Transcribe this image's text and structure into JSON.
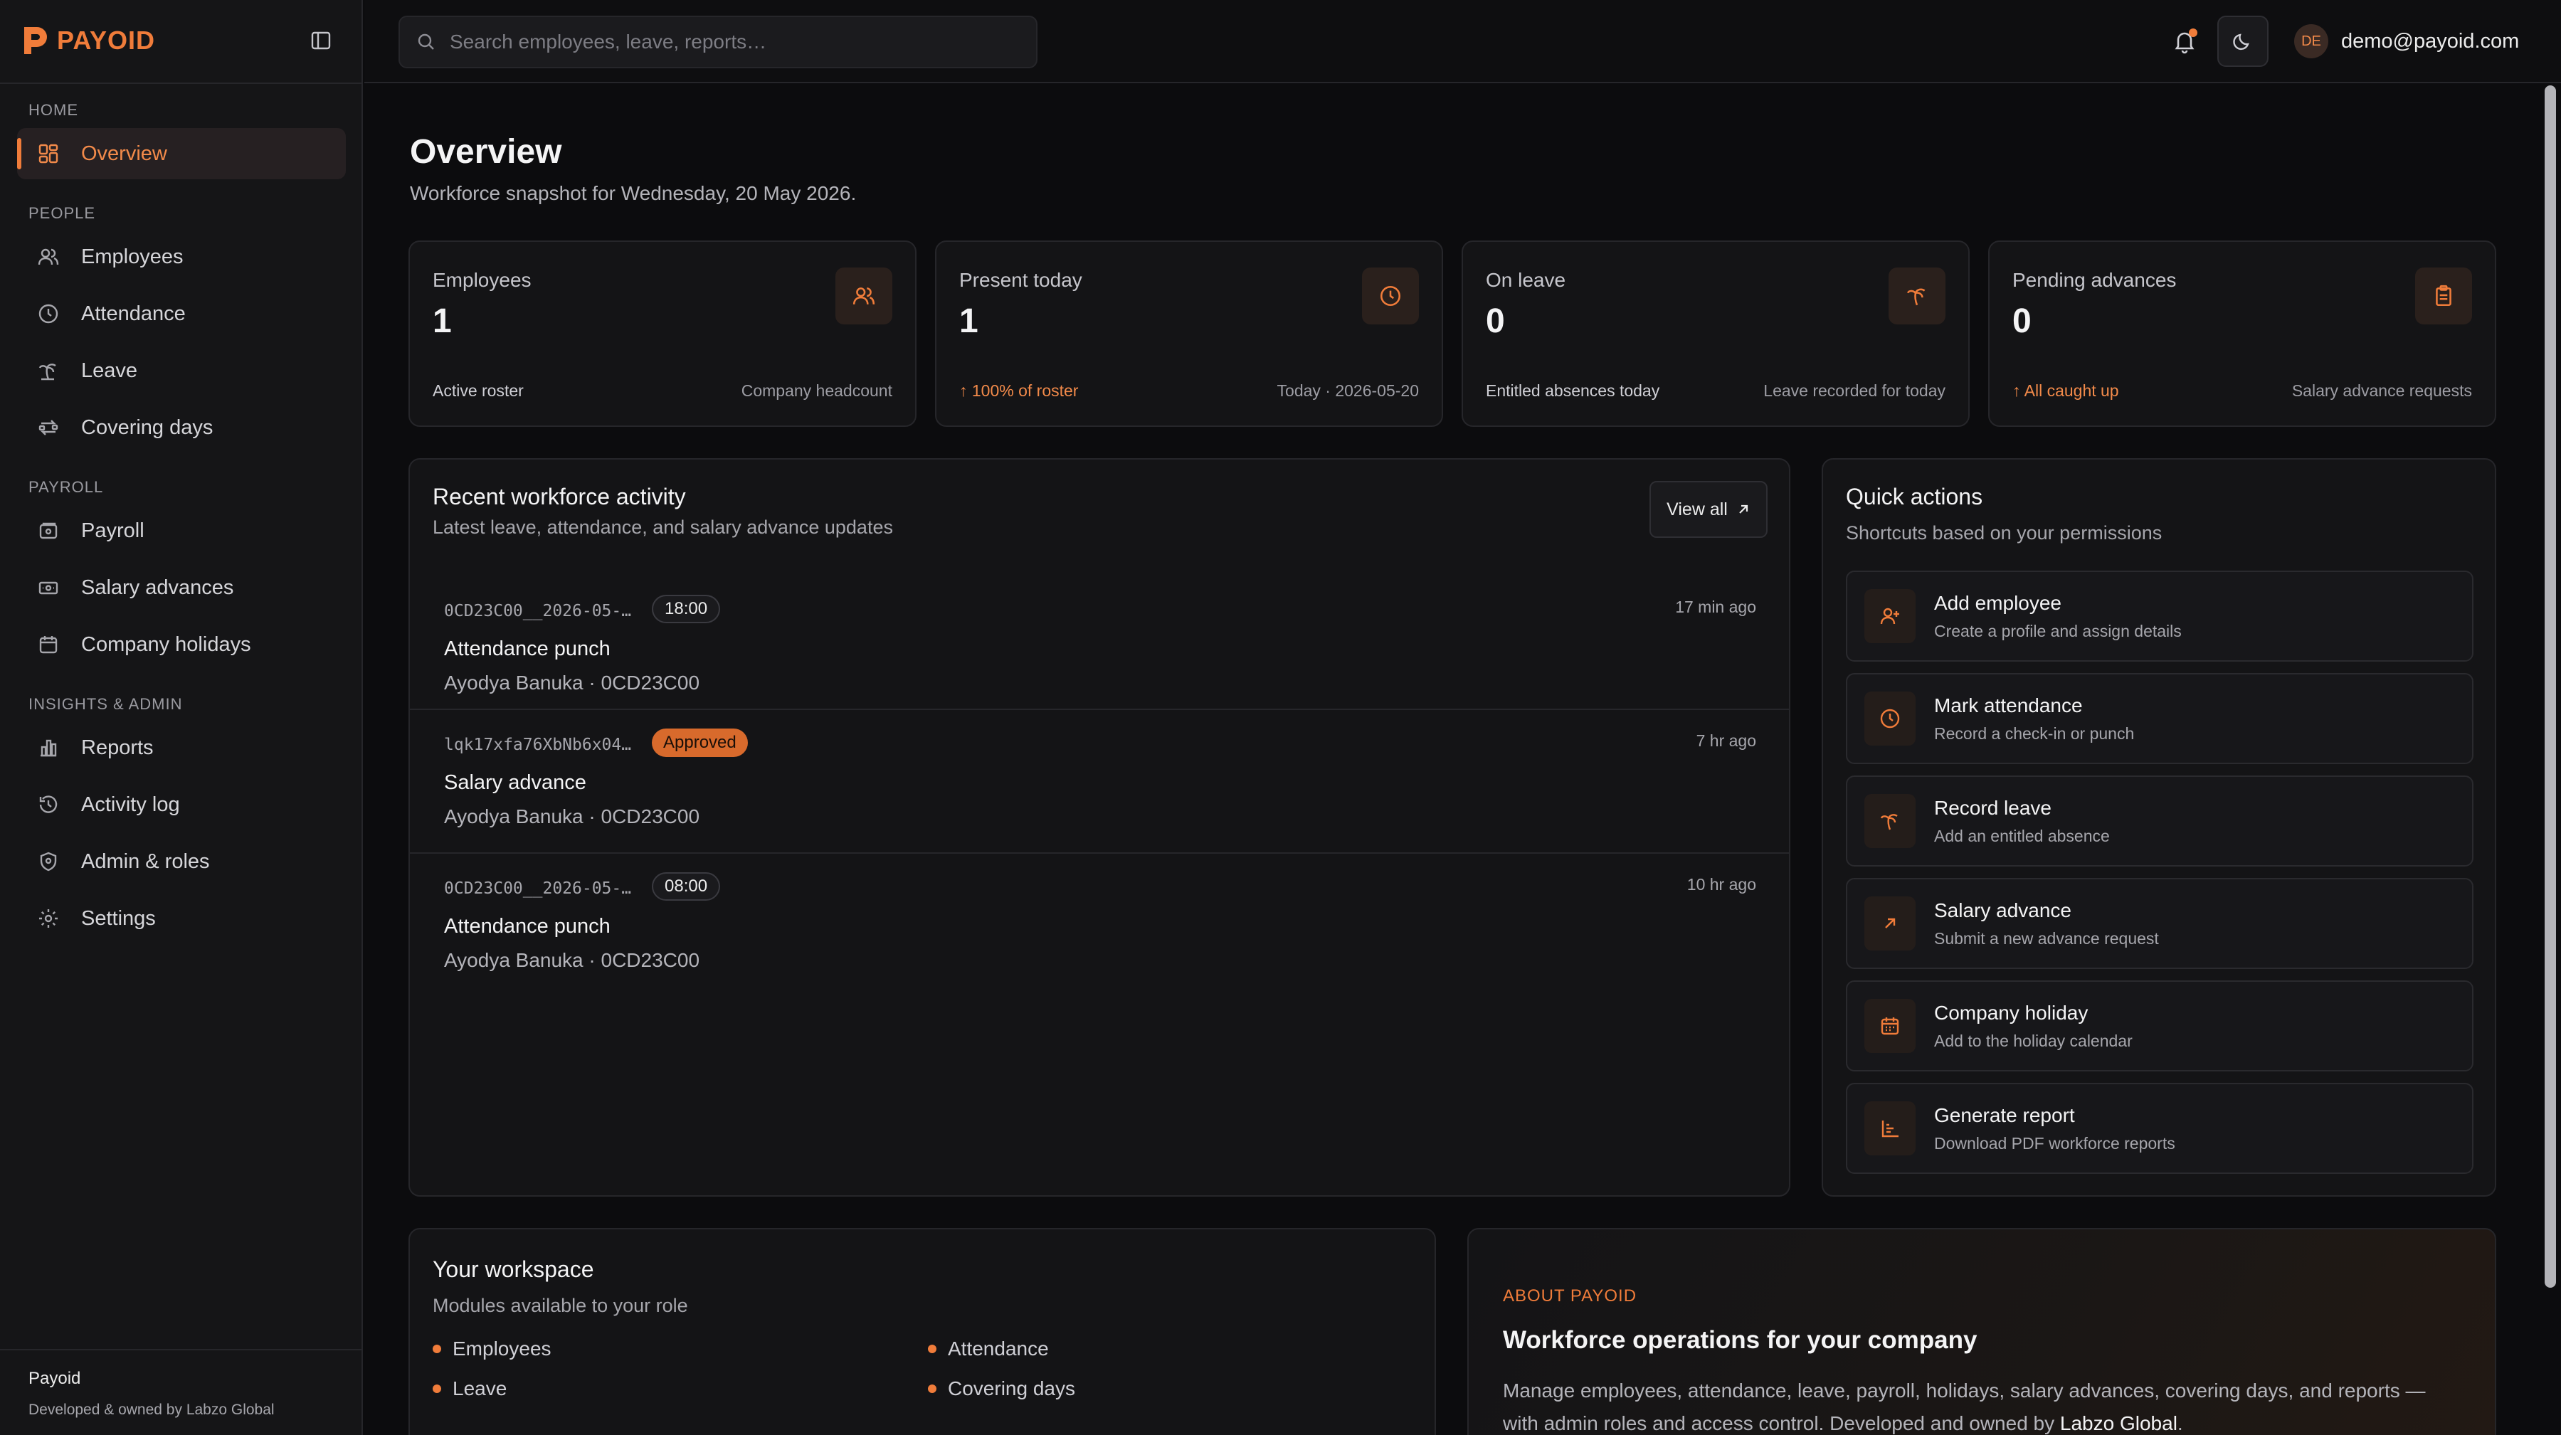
{
  "brand": {
    "name": "PAYOID"
  },
  "nav": {
    "sections": {
      "home": "HOME",
      "people": "PEOPLE",
      "payroll": "PAYROLL",
      "insights": "INSIGHTS & ADMIN"
    },
    "items": {
      "overview": "Overview",
      "employees": "Employees",
      "attendance": "Attendance",
      "leave": "Leave",
      "covering_days": "Covering days",
      "payroll": "Payroll",
      "salary_advances": "Salary advances",
      "company_holidays": "Company holidays",
      "reports": "Reports",
      "activity_log": "Activity log",
      "admin_roles": "Admin & roles",
      "settings": "Settings"
    },
    "active": "overview"
  },
  "sidebar_footer": {
    "title": "Payoid",
    "subtitle": "Developed & owned by Labzo Global"
  },
  "header": {
    "search_placeholder": "Search employees, leave, reports…",
    "user_initials": "DE",
    "user_email": "demo@payoid.com"
  },
  "page": {
    "title": "Overview",
    "subtitle": "Workforce snapshot for Wednesday, 20 May 2026."
  },
  "stats": [
    {
      "label": "Employees",
      "value": "1",
      "foot_left": "Active roster",
      "foot_right": "Company headcount",
      "icon": "users-icon"
    },
    {
      "label": "Present today",
      "value": "1",
      "foot_left": "↑ 100% of roster",
      "foot_right": "Today · 2026-05-20",
      "icon": "clock-icon"
    },
    {
      "label": "On leave",
      "value": "0",
      "foot_left": "Entitled absences today",
      "foot_right": "Leave recorded for today",
      "icon": "palm-tree-icon"
    },
    {
      "label": "Pending advances",
      "value": "0",
      "foot_left": "↑ All caught up",
      "foot_right": "Salary advance requests",
      "icon": "clipboard-icon"
    }
  ],
  "activity": {
    "title": "Recent workforce activity",
    "subtitle": "Latest leave, attendance, and salary advance updates",
    "view_all": "View all",
    "items": [
      {
        "id": "0CD23C00__2026-05-…",
        "badge": "18:00",
        "title": "Attendance punch",
        "person": "Ayodya Banuka · 0CD23C00",
        "time": "17 min ago"
      },
      {
        "id": "lqk17xfa76XbNb6x04…",
        "badge": "Approved",
        "title": "Salary advance",
        "person": "Ayodya Banuka · 0CD23C00",
        "time": "7 hr ago"
      },
      {
        "id": "0CD23C00__2026-05-…",
        "badge": "08:00",
        "title": "Attendance punch",
        "person": "Ayodya Banuka · 0CD23C00",
        "time": "10 hr ago"
      }
    ]
  },
  "quick_actions": {
    "title": "Quick actions",
    "subtitle": "Shortcuts based on your permissions",
    "items": [
      {
        "title": "Add employee",
        "subtitle": "Create a profile and assign details",
        "icon": "user-plus-icon"
      },
      {
        "title": "Mark attendance",
        "subtitle": "Record a check-in or punch",
        "icon": "clock-icon"
      },
      {
        "title": "Record leave",
        "subtitle": "Add an entitled absence",
        "icon": "palm-tree-icon"
      },
      {
        "title": "Salary advance",
        "subtitle": "Submit a new advance request",
        "icon": "arrow-up-right-icon"
      },
      {
        "title": "Company holiday",
        "subtitle": "Add to the holiday calendar",
        "icon": "calendar-icon"
      },
      {
        "title": "Generate report",
        "subtitle": "Download PDF workforce reports",
        "icon": "chart-icon"
      }
    ]
  },
  "workspace": {
    "title": "Your workspace",
    "subtitle": "Modules available to your role",
    "modules": [
      "Employees",
      "Attendance",
      "Leave",
      "Covering days"
    ]
  },
  "about": {
    "label": "ABOUT PAYOID",
    "title": "Workforce operations for your company",
    "text": "Manage employees, attendance, leave, payroll, holidays, salary advances, covering days, and reports — with admin roles and access control. Developed and owned by",
    "owner": "Labzo Global",
    "end": "."
  },
  "colors": {
    "accent": "#f07c3a",
    "background": "#0c0c0e",
    "card": "#141416",
    "border": "#26262a"
  }
}
